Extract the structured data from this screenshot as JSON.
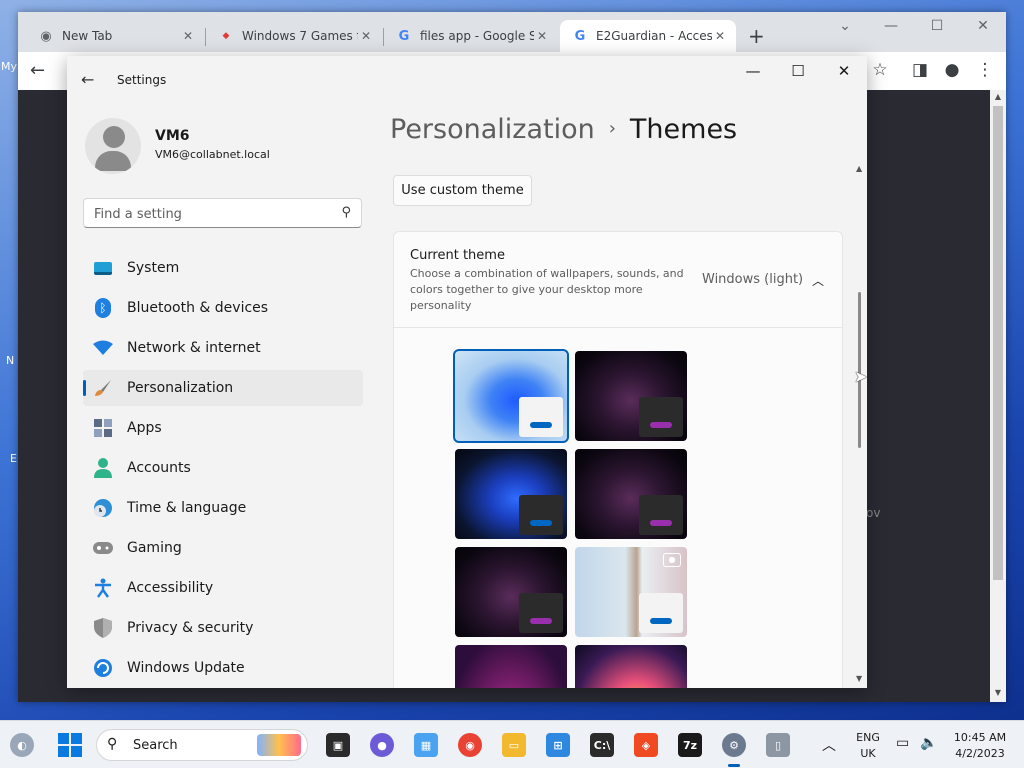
{
  "desktop": {
    "fragments": [
      "My",
      "N",
      "E"
    ]
  },
  "browser": {
    "tabs": [
      {
        "title": "New Tab",
        "icon": "chrome-icon"
      },
      {
        "title": "Windows 7 Games fo",
        "icon": "games-icon"
      },
      {
        "title": "files app - Google Se",
        "icon": "google-icon"
      },
      {
        "title": "E2Guardian - Access",
        "icon": "google-icon"
      }
    ],
    "new_tab_label": "+",
    "ghost_text": "ov"
  },
  "settings": {
    "window_title": "Settings",
    "user": {
      "name": "VM6",
      "email": "VM6@collabnet.local"
    },
    "search_placeholder": "Find a setting",
    "nav": [
      {
        "label": "System",
        "icon": "system-icon",
        "color": "#1f9fd6"
      },
      {
        "label": "Bluetooth & devices",
        "icon": "bluetooth-icon",
        "color": "#1f7fe0"
      },
      {
        "label": "Network & internet",
        "icon": "wifi-icon",
        "color": "#1f7fe0"
      },
      {
        "label": "Personalization",
        "icon": "brush-icon",
        "color": "#e08a3c",
        "selected": true
      },
      {
        "label": "Apps",
        "icon": "apps-icon",
        "color": "#5b6b84"
      },
      {
        "label": "Accounts",
        "icon": "accounts-icon",
        "color": "#2fb38a"
      },
      {
        "label": "Time & language",
        "icon": "clock-globe-icon",
        "color": "#2f8fd6"
      },
      {
        "label": "Gaming",
        "icon": "gamepad-icon",
        "color": "#7a7a7a"
      },
      {
        "label": "Accessibility",
        "icon": "accessibility-icon",
        "color": "#1f7fe0"
      },
      {
        "label": "Privacy & security",
        "icon": "shield-icon",
        "color": "#7a7a7a"
      },
      {
        "label": "Windows Update",
        "icon": "update-icon",
        "color": "#1f7fe0"
      }
    ],
    "breadcrumb": {
      "parent": "Personalization",
      "separator": "›",
      "current": "Themes"
    },
    "custom_theme_button": "Use custom theme",
    "current_theme": {
      "title": "Current theme",
      "description": "Choose a combination of wallpapers, sounds, and colors together to give your desktop more personality",
      "value": "Windows (light)"
    },
    "themes": [
      {
        "name": "windows-light",
        "bg": "bg-bloom-light",
        "mini": "light",
        "accent": "blue",
        "selected": true
      },
      {
        "name": "glow-dark",
        "bg": "bg-glow-dark",
        "mini": "dark",
        "accent": "purple"
      },
      {
        "name": "windows-dark",
        "bg": "bg-bloom-dark",
        "mini": "dark",
        "accent": "blue"
      },
      {
        "name": "glow",
        "bg": "bg-glow-dark",
        "mini": "dark",
        "accent": "purple"
      },
      {
        "name": "captured-motion",
        "bg": "bg-glow-dark",
        "mini": "dark",
        "accent": "purple"
      },
      {
        "name": "spotlight-flower",
        "bg": "bg-flower",
        "mini": "light",
        "accent": "blue",
        "camera": true
      },
      {
        "name": "sunrise",
        "bg": "bg-purple-glow"
      },
      {
        "name": "flow",
        "bg": "bg-bloom-color"
      }
    ]
  },
  "taskbar": {
    "search_label": "Search",
    "language": {
      "line1": "ENG",
      "line2": "UK"
    },
    "clock": {
      "time": "10:45 AM",
      "date": "4/2/2023"
    }
  }
}
